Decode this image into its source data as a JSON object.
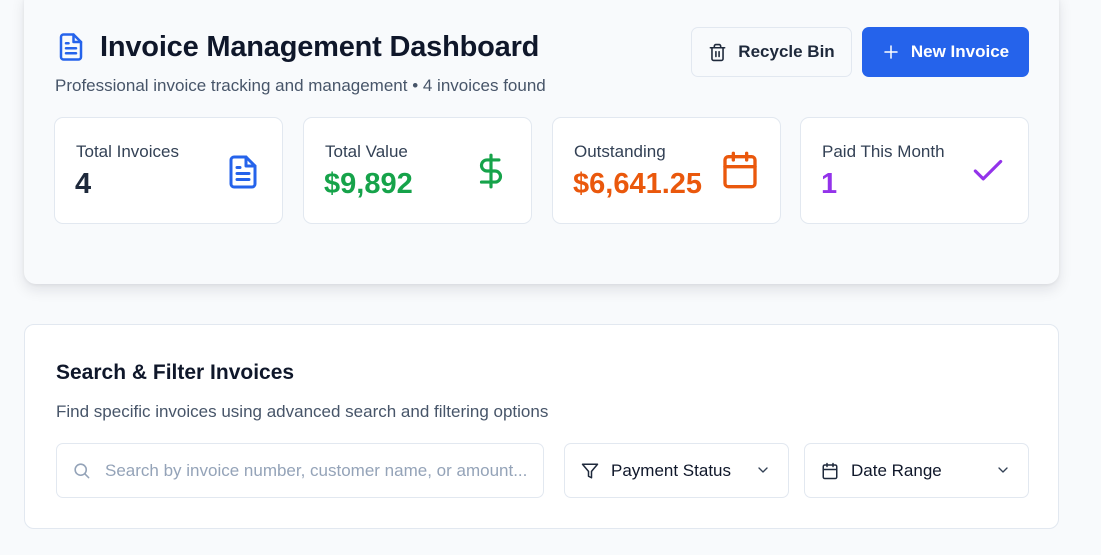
{
  "header": {
    "title": "Invoice Management Dashboard",
    "subtitle": "Professional invoice tracking and management • 4 invoices found",
    "recycle_label": "Recycle Bin",
    "new_invoice_label": "New Invoice"
  },
  "stats": [
    {
      "label": "Total Invoices",
      "value": "4",
      "color": "#1e293b",
      "icon": "document-icon",
      "icon_color": "#2563eb"
    },
    {
      "label": "Total Value",
      "value": "$9,892",
      "color": "#16a34a",
      "icon": "dollar-icon",
      "icon_color": "#16a34a"
    },
    {
      "label": "Outstanding",
      "value": "$6,641.25",
      "color": "#ea580c",
      "icon": "calendar-icon",
      "icon_color": "#ea580c"
    },
    {
      "label": "Paid This Month",
      "value": "1",
      "color": "#9333ea",
      "icon": "check-icon",
      "icon_color": "#9333ea"
    }
  ],
  "filters": {
    "title": "Search & Filter Invoices",
    "subtitle": "Find specific invoices using advanced search and filtering options",
    "search_placeholder": "Search by invoice number, customer name, or amount...",
    "search_value": "",
    "payment_status_label": "Payment Status",
    "date_range_label": "Date Range"
  },
  "colors": {
    "primary": "#2563eb",
    "success": "#16a34a",
    "warning": "#ea580c",
    "purple": "#9333ea"
  }
}
